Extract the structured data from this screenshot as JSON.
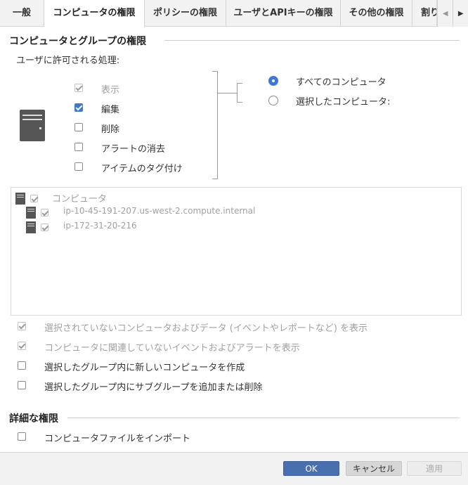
{
  "tabs": [
    {
      "label": "一般",
      "active": false
    },
    {
      "label": "コンピュータの権限",
      "active": true
    },
    {
      "label": "ポリシーの権限",
      "active": false
    },
    {
      "label": "ユーザとAPIキーの権限",
      "active": false
    },
    {
      "label": "その他の権限",
      "active": false
    },
    {
      "label": "割り",
      "active": false
    }
  ],
  "section1": {
    "title": "コンピュータとグループの権限",
    "subtitle": "ユーザに許可される処理:",
    "actions": [
      {
        "label": "表示",
        "checked": true,
        "disabled": true
      },
      {
        "label": "編集",
        "checked": true,
        "disabled": false
      },
      {
        "label": "削除",
        "checked": false,
        "disabled": false
      },
      {
        "label": "アラートの消去",
        "checked": false,
        "disabled": false
      },
      {
        "label": "アイテムのタグ付け",
        "checked": false,
        "disabled": false
      }
    ],
    "scope": [
      {
        "label": "すべてのコンピュータ",
        "selected": true
      },
      {
        "label": "選択したコンピュータ:",
        "selected": false
      }
    ]
  },
  "tree": {
    "root": {
      "label": "コンピュータ",
      "checked": true
    },
    "children": [
      {
        "label": "ip-10-45-191-207.us-west-2.compute.internal",
        "checked": true
      },
      {
        "label": "ip-172-31-20-216",
        "checked": true
      }
    ]
  },
  "options": [
    {
      "label": "選択されていないコンピュータおよびデータ (イベントやレポートなど) を表示",
      "checked": true,
      "disabled": true
    },
    {
      "label": "コンピュータに関連していないイベントおよびアラートを表示",
      "checked": true,
      "disabled": true
    },
    {
      "label": "選択したグループ内に新しいコンピュータを作成",
      "checked": false,
      "disabled": false
    },
    {
      "label": "選択したグループ内にサブグループを追加または削除",
      "checked": false,
      "disabled": false
    }
  ],
  "section2": {
    "title": "詳細な権限",
    "items": [
      {
        "label": "コンピュータファイルをインポート",
        "checked": false
      }
    ]
  },
  "footer": {
    "ok": "OK",
    "cancel": "キャンセル",
    "apply": "適用"
  },
  "colors": {
    "accent": "#3d78d8",
    "ok_button": "#4a6fb0"
  }
}
